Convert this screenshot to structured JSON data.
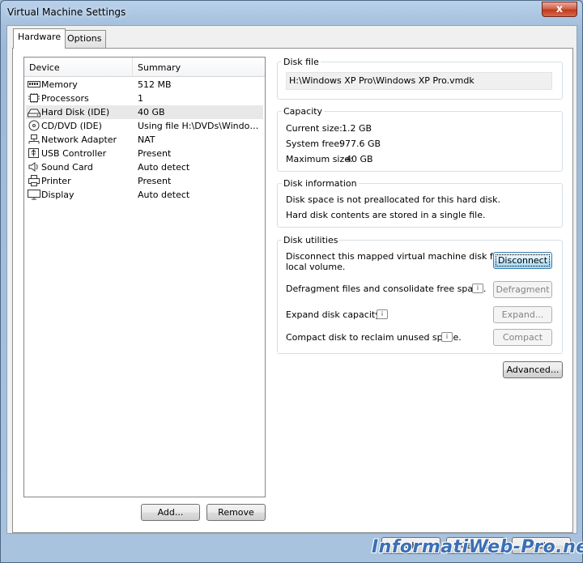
{
  "window": {
    "title": "Virtual Machine Settings",
    "close_glyph": "x"
  },
  "tabs": [
    {
      "label": "Hardware"
    },
    {
      "label": "Options"
    }
  ],
  "device_list": {
    "columns": {
      "device": "Device",
      "summary": "Summary"
    },
    "rows": [
      {
        "device": "Memory",
        "summary": "512 MB",
        "icon": "memory-icon"
      },
      {
        "device": "Processors",
        "summary": "1",
        "icon": "processor-icon"
      },
      {
        "device": "Hard Disk (IDE)",
        "summary": "40 GB",
        "icon": "hard-disk-icon"
      },
      {
        "device": "CD/DVD (IDE)",
        "summary": "Using file H:\\DVDs\\Windows ...",
        "icon": "cd-dvd-icon"
      },
      {
        "device": "Network Adapter",
        "summary": "NAT",
        "icon": "network-adapter-icon"
      },
      {
        "device": "USB Controller",
        "summary": "Present",
        "icon": "usb-icon"
      },
      {
        "device": "Sound Card",
        "summary": "Auto detect",
        "icon": "speaker-icon"
      },
      {
        "device": "Printer",
        "summary": "Present",
        "icon": "printer-icon"
      },
      {
        "device": "Display",
        "summary": "Auto detect",
        "icon": "display-icon"
      }
    ],
    "selected_index": 2
  },
  "list_buttons": {
    "add": "Add...",
    "remove": "Remove"
  },
  "disk_file": {
    "title": "Disk file",
    "path": "H:\\Windows XP Pro\\Windows XP Pro.vmdk"
  },
  "capacity": {
    "title": "Capacity",
    "current_label": "Current size:",
    "current_value": "1.2 GB",
    "free_label": "System free:",
    "free_value": "977.6 GB",
    "max_label": "Maximum size:",
    "max_value": "40 GB"
  },
  "disk_info": {
    "title": "Disk information",
    "line1": "Disk space is not preallocated for this hard disk.",
    "line2": "Hard disk contents are stored in a single file."
  },
  "disk_utilities": {
    "title": "Disk utilities",
    "disconnect_text_1": "Disconnect this mapped virtual machine disk from a",
    "disconnect_text_2": "local volume.",
    "disconnect_button": "Disconnect",
    "defrag_text": "Defragment files and consolidate free space.",
    "defrag_button": "Defragment",
    "expand_text": "Expand disk capacity.",
    "expand_button": "Expand...",
    "compact_text": "Compact disk to reclaim unused space.",
    "compact_button": "Compact"
  },
  "advanced_button": "Advanced...",
  "footer": {
    "ok": "OK",
    "cancel": "Cancel",
    "help": "Help"
  },
  "watermark": "InformatiWeb-Pro.net",
  "info_glyph": "i"
}
